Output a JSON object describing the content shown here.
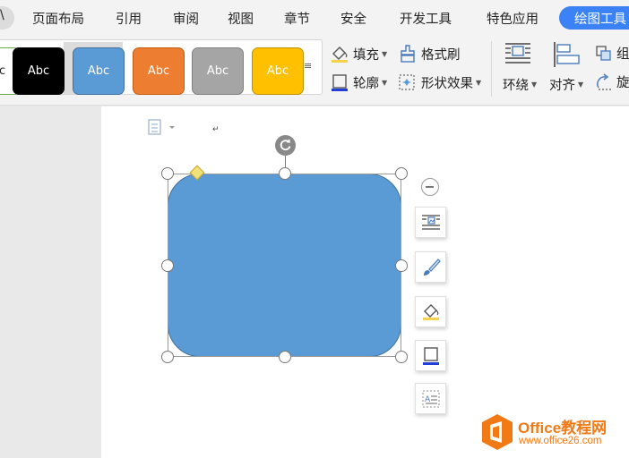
{
  "menu": {
    "partial_left": "\\",
    "items": [
      "页面布局",
      "引用",
      "审阅",
      "视图",
      "章节",
      "安全",
      "开发工具",
      "特色应用"
    ],
    "active_tab": "绘图工具"
  },
  "ribbon": {
    "style_gallery": [
      {
        "label": "Abc",
        "bg": "#ffffff",
        "fg": "#222222",
        "border": "#70ad47"
      },
      {
        "label": "Abc",
        "bg": "#000000",
        "fg": "#ffffff",
        "border": "#000000"
      },
      {
        "label": "Abc",
        "bg": "#5b9bd5",
        "fg": "#ffffff",
        "border": "#41719c"
      },
      {
        "label": "Abc",
        "bg": "#ed7d31",
        "fg": "#ffffff",
        "border": "#c55a11"
      },
      {
        "label": "Abc",
        "bg": "#a5a5a5",
        "fg": "#ffffff",
        "border": "#7f7f7f"
      },
      {
        "label": "Abc",
        "bg": "#ffc000",
        "fg": "#ffffff",
        "border": "#bf9000"
      }
    ],
    "fill_label": "填充",
    "outline_label": "轮廓",
    "format_painter_label": "格式刷",
    "shape_effects_label": "形状效果",
    "wrap_label": "环绕",
    "align_label": "对齐",
    "group_label": "组",
    "rotate_label": "旋"
  },
  "shape": {
    "fill_color": "#5b9bd5",
    "border_color": "#41719c"
  },
  "watermark": {
    "title": "Office教程网",
    "url": "www.office26.com"
  },
  "colors": {
    "accent": "#3b82f6",
    "logo_orange": "#f27a16"
  }
}
